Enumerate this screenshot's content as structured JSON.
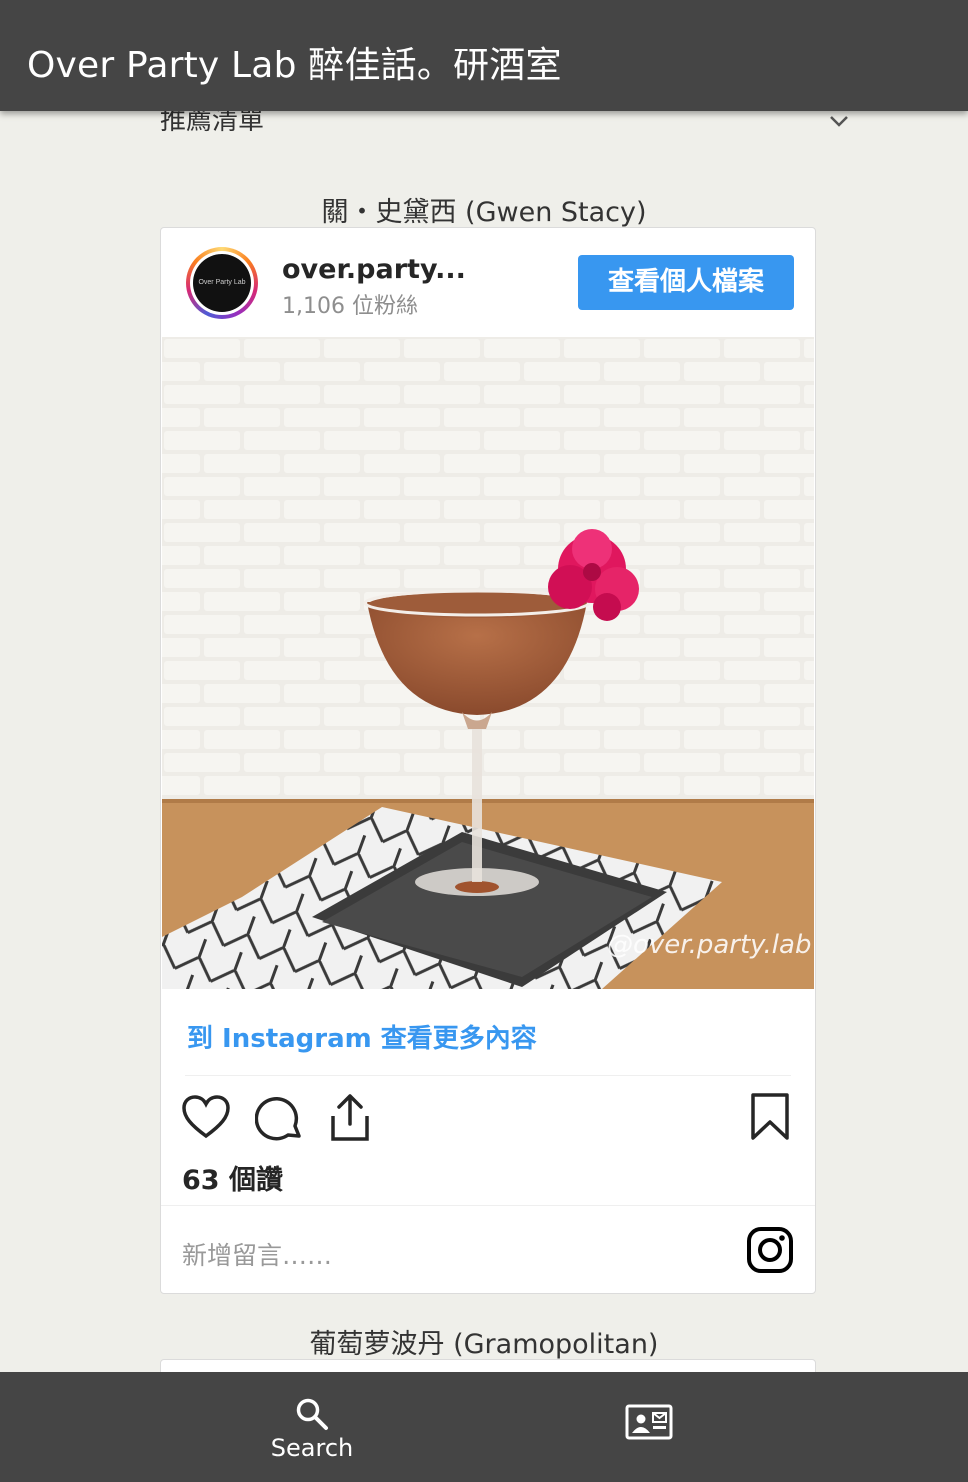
{
  "app": {
    "title": "Over Party Lab 醉佳話。研酒室"
  },
  "section": {
    "label": "推薦清單"
  },
  "posts": [
    {
      "cocktail_name": "關・史黛西 (Gwen Stacy)",
      "username": "over.party...",
      "followers": "1,106 位粉絲",
      "profile_button": "查看個人檔案",
      "avatar_text": "Over Party Lab",
      "watermark": "@over.party.lab",
      "more_link": "到 Instagram 查看更多內容",
      "likes": "63 個讚",
      "comment_placeholder": "新增留言……"
    },
    {
      "cocktail_name": "葡萄萝波丹 (Gramopolitan)"
    }
  ],
  "nav": {
    "search_label": "Search"
  },
  "colors": {
    "bar": "#454545",
    "ig_blue": "#3897f0",
    "page_bg": "#efefea"
  }
}
